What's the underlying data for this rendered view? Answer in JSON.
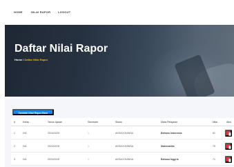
{
  "nav": {
    "links": [
      "HOME",
      "NILAI RAPOR",
      "LOGOUT"
    ]
  },
  "hero": {
    "title": "Daftar Nilai Rapor",
    "breadcrumb_home": "Home",
    "breadcrumb_sep": " / ",
    "breadcrumb_current": "Daftar Nilai Rapor"
  },
  "actions": {
    "add_label": "Tambah Nilai Rapor Baru"
  },
  "table": {
    "headers": [
      "#",
      "Kelas",
      "Tahun Ajaran",
      "Semester",
      "Siswa",
      "Mata Pelajaran",
      "Nilai",
      "Aksi"
    ],
    "rows": [
      [
        "1",
        "IVA",
        "2024/2025",
        "1",
        "AISSA KHANSA",
        "Bahasa Indonesia",
        "81"
      ],
      [
        "2",
        "IVA",
        "2024/2025",
        "1",
        "AISSA KHANSA",
        "Matematika",
        "75"
      ],
      [
        "3",
        "IVA",
        "2024/2025",
        "1",
        "AISSA KHANSA",
        "Bahasa Inggris",
        "71"
      ]
    ]
  },
  "colors": {
    "accent": "#1e88e5",
    "delete": "#dc3545",
    "breadcrumb_current": "#f2b705"
  },
  "icons": {
    "delete": "trash-icon"
  }
}
